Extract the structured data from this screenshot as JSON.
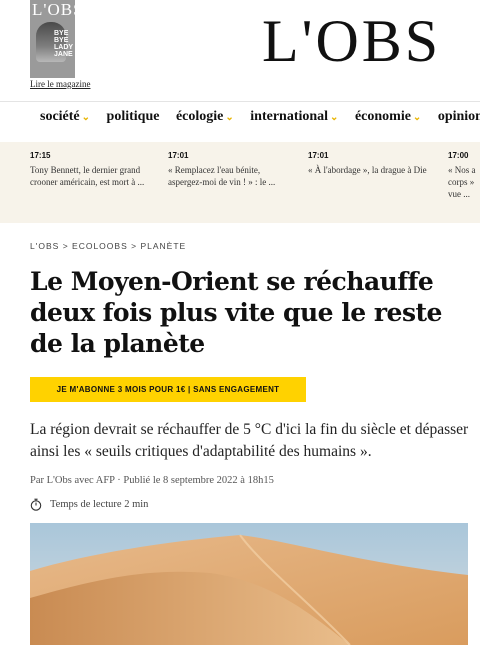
{
  "header": {
    "magazine_cover": {
      "masthead": "L'OBS",
      "headline": "BYE BYE LADY JANE"
    },
    "read_magazine_link": "Lire le magazine",
    "logo": "L'OBS"
  },
  "nav": {
    "items": [
      {
        "label": "société",
        "has_dropdown": true
      },
      {
        "label": "politique",
        "has_dropdown": false
      },
      {
        "label": "écologie",
        "has_dropdown": true
      },
      {
        "label": "international",
        "has_dropdown": true
      },
      {
        "label": "économie",
        "has_dropdown": true
      },
      {
        "label": "opinions",
        "has_dropdown": true
      }
    ],
    "chevron_icon": "chevron-down-icon",
    "accent_color": "#e8b400"
  },
  "live_feed": [
    {
      "time": "17:15",
      "text": "Tony Bennett, le dernier grand crooner américain, est mort à ..."
    },
    {
      "time": "17:01",
      "text": "« Remplacez l'eau bénite, aspergez-moi de vin ! » : le ..."
    },
    {
      "time": "17:01",
      "text": "« À l'abordage », la drague à Die"
    },
    {
      "time": "17:00",
      "text": "« Nos a corps » vue ..."
    }
  ],
  "breadcrumb": [
    "L'OBS",
    "ECOLOOBS",
    "PLANÈTE"
  ],
  "breadcrumb_separator": ">",
  "article": {
    "title": "Le Moyen-Orient se réchauffe deux fois plus vite que le reste de la planète",
    "cta": "JE M'ABONNE 3 MOIS POUR 1€ | SANS ENGAGEMENT",
    "cta_color": "#ffd200",
    "lead": "La région devrait se réchauffer de 5 °C d'ici la fin du siècle et dépasser ainsi les « seuils critiques d'adaptabilité des humains ».",
    "byline": "Par L'Obs avec AFP · Publié le 8 septembre 2022 à 18h15",
    "reading_time": "Temps de lecture 2 min",
    "reading_icon": "stopwatch-icon",
    "hero_image": "desert-dunes-photo"
  }
}
